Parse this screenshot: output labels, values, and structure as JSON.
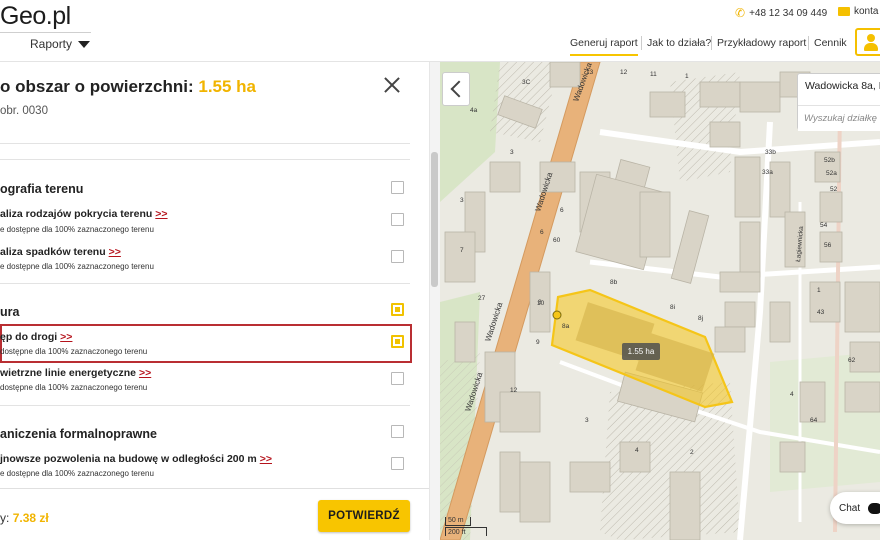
{
  "header": {
    "logo": "Geo.pl",
    "reports_menu": "Raporty",
    "phone": "+48 12 34 09 449",
    "email": "konta",
    "nav": [
      "Generuj raport",
      "Jak to działa?",
      "Przykładowy raport",
      "Cennik"
    ],
    "active_nav": "Generuj raport"
  },
  "panel": {
    "title_prefix": "o obszar o powierzchni:",
    "area": "1.55 ha",
    "subtitle": "obr. 0030",
    "sections": [
      {
        "heading": "ografia terenu",
        "items": [
          {
            "title": "aliza rodzajów pokrycia terenu",
            "more": ">>",
            "sub": "e dostępne dla 100% zaznaczonego terenu",
            "checked": false
          },
          {
            "title": "aliza spadków terenu",
            "more": ">>",
            "sub": "e dostępne dla 100% zaznaczonego terenu",
            "checked": false
          }
        ]
      },
      {
        "heading": "ura",
        "items": [
          {
            "title": "ęp do drogi",
            "more": ">>",
            "sub": "dostępne dla 100% zaznaczonego terenu",
            "checked": true
          },
          {
            "title": "wietrzne linie energetyczne",
            "more": ">>",
            "sub": "dostępne dla 100% zaznaczonego terenu",
            "checked": false
          }
        ]
      },
      {
        "heading": "aniczenia formalnoprawne",
        "items": [
          {
            "title": "jnowsze pozwolenia na budowę w odległości 200 m",
            "more": ">>",
            "sub": "e dostępne dla 100% zaznaczonego terenu",
            "checked": false
          }
        ]
      }
    ],
    "price_label": "y:",
    "price": "7.38 zł",
    "confirm_button": "POTWIERDŹ"
  },
  "map": {
    "address": "Wadowicka 8a, Kr",
    "search_placeholder": "Wyszukaj działkę",
    "area_badge": "1.55 ha",
    "scale_m": "50 m",
    "scale_ft": "200 ft",
    "street_labels": [
      "Wadowicka",
      "Wadowicka",
      "Wadowicka",
      "Wadowicka",
      "Łagiewnicka"
    ],
    "building_numbers": [
      "3C",
      "4a",
      "3",
      "13",
      "12",
      "11",
      "1",
      "3",
      "7",
      "9",
      "8",
      "6",
      "6",
      "60",
      "27",
      "10",
      "8a",
      "8b",
      "8i",
      "8j",
      "12",
      "3",
      "4",
      "2",
      "5",
      "33b",
      "33a",
      "52b",
      "52a",
      "52",
      "54",
      "56",
      "1",
      "43",
      "4",
      "64",
      "62"
    ],
    "colors": {
      "parcel": "#f5c518",
      "road": "#e8b27a",
      "building": "#d9d4c7"
    }
  },
  "chat": {
    "label": "Chat"
  }
}
